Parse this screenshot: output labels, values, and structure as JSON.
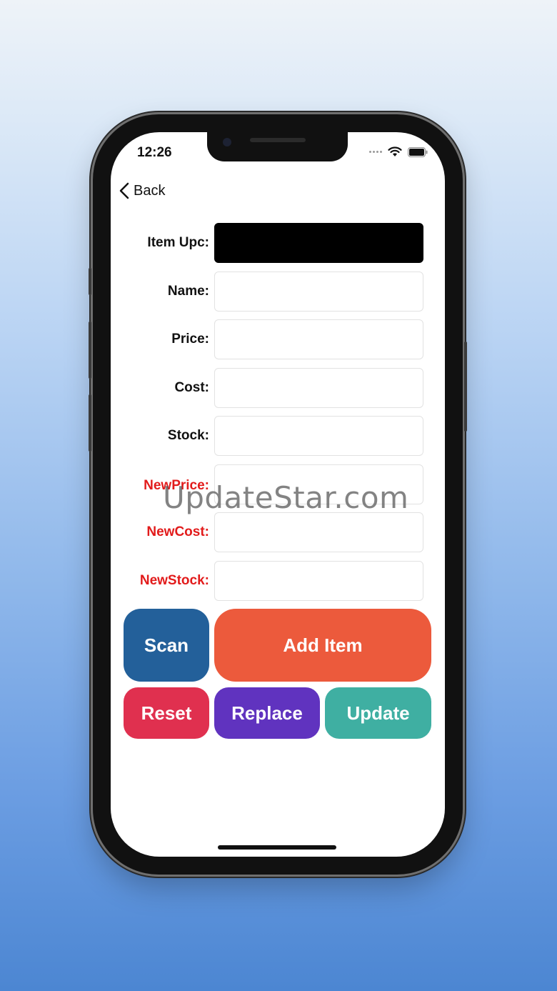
{
  "status_bar": {
    "time": "12:26",
    "icons": [
      "signal-icon",
      "wifi-icon",
      "battery-icon"
    ]
  },
  "nav": {
    "back_label": "Back"
  },
  "form": {
    "upc_label": "Item Upc:",
    "name_label": "Name:",
    "price_label": "Price:",
    "cost_label": "Cost:",
    "stock_label": "Stock:",
    "new_price_label": "NewPrice:",
    "new_cost_label": "NewCost:",
    "new_stock_label": "NewStock:"
  },
  "buttons": {
    "scan": "Scan",
    "add_item": "Add Item",
    "reset": "Reset",
    "replace": "Replace",
    "update": "Update"
  },
  "colors": {
    "scan": "#23609a",
    "add_item": "#ec5a3c",
    "reset": "#e0304f",
    "replace": "#6033bf",
    "update": "#3fafa2",
    "label_highlight": "#e21b1b"
  },
  "watermark": "UpdateStar.com"
}
